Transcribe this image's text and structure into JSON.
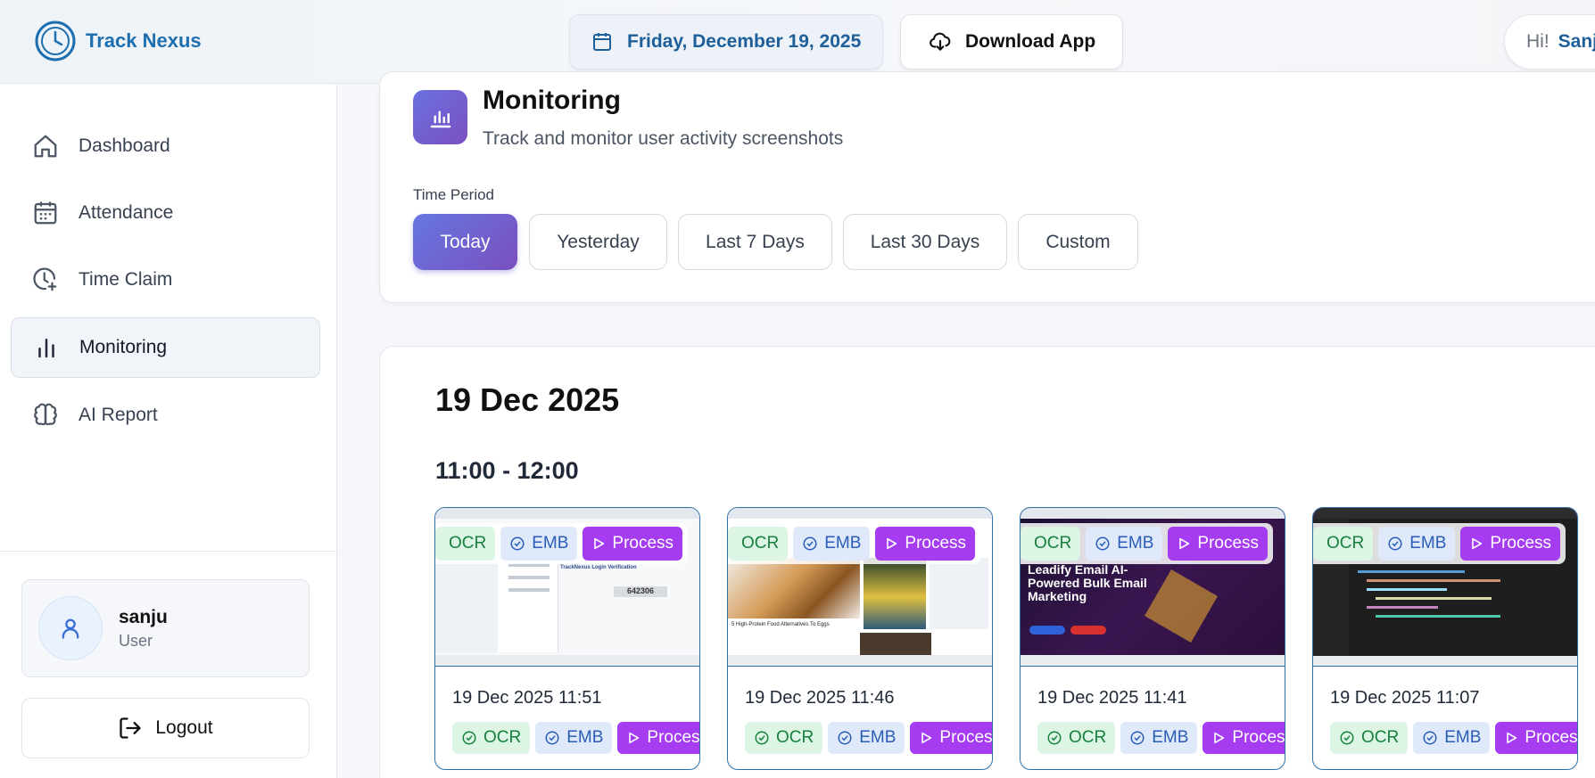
{
  "header": {
    "brand": "Track Nexus",
    "date": "Friday, December 19, 2025",
    "download_label": "Download App",
    "greeting": "Hi!",
    "user_short": "Sanj"
  },
  "sidebar": {
    "items": [
      {
        "label": "Dashboard",
        "icon": "home-icon"
      },
      {
        "label": "Attendance",
        "icon": "calendar-icon"
      },
      {
        "label": "Time Claim",
        "icon": "clock-plus-icon"
      },
      {
        "label": "Monitoring",
        "icon": "bar-chart-icon",
        "active": true
      },
      {
        "label": "AI Report",
        "icon": "brain-icon"
      }
    ],
    "user": {
      "name": "sanju",
      "role": "User"
    },
    "logout_label": "Logout"
  },
  "monitoring": {
    "title": "Monitoring",
    "subtitle": "Track and monitor user activity screenshots",
    "period_label": "Time Period",
    "periods": [
      "Today",
      "Yesterday",
      "Last 7 Days",
      "Last 30 Days",
      "Custom"
    ],
    "active_period": "Today"
  },
  "screenshots": {
    "day": "19 Dec 2025",
    "hour_range": "11:00 - 12:00",
    "chip_labels": {
      "ocr": "OCR",
      "emb": "EMB",
      "process": "Process",
      "process_cut": "Proces"
    },
    "items": [
      {
        "time": "19 Dec 2025 11:51",
        "thumb_text": "TrackNexus Login Verification",
        "thumb_code": "642306"
      },
      {
        "time": "19 Dec 2025 11:46",
        "thumb_text": "5 High-Protein Food Alternatives To Eggs"
      },
      {
        "time": "19 Dec 2025 11:41",
        "thumb_text": "Leadify Email AI-Powered Bulk Email Marketing"
      },
      {
        "time": "19 Dec 2025 11:07",
        "thumb_text": ""
      }
    ]
  },
  "colors": {
    "brand": "#1d6fb0",
    "accent_gradient_start": "#6677e0",
    "accent_gradient_end": "#7a4fbf",
    "process": "#a63cf0",
    "ocr_bg": "#dcf5e5",
    "emb_bg": "#dfe9fa"
  }
}
